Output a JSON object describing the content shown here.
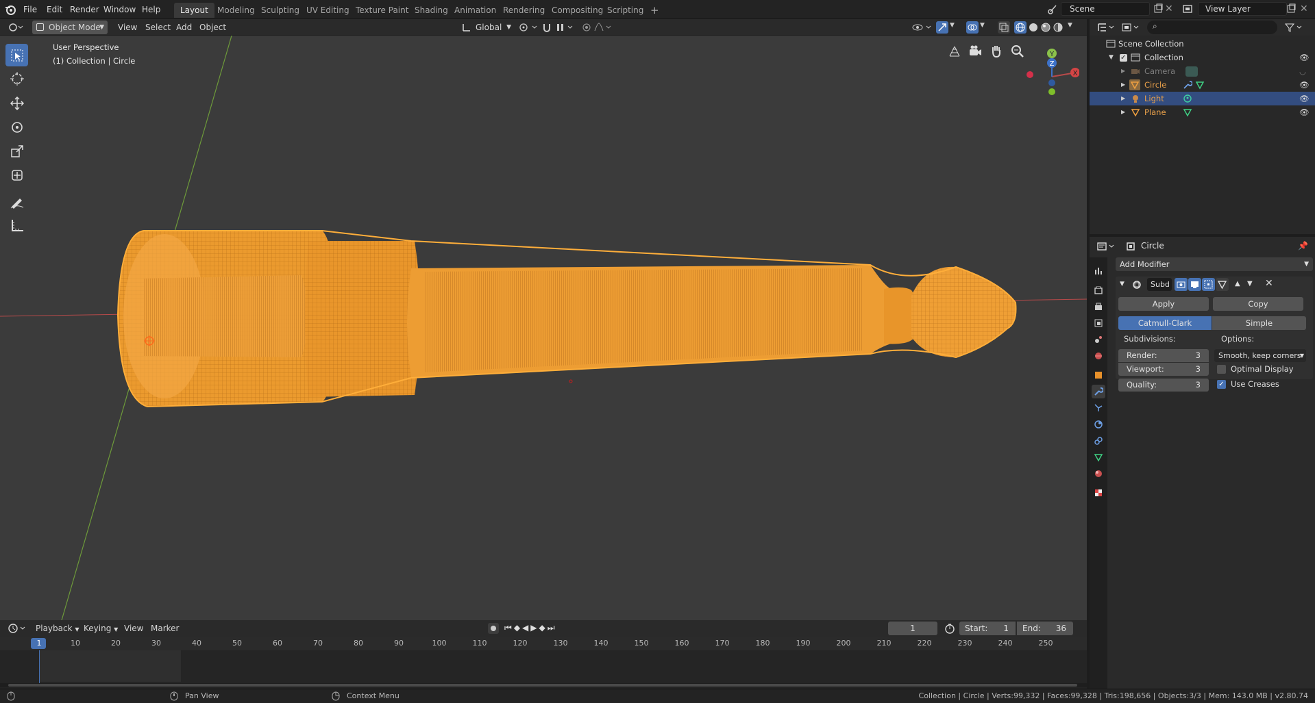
{
  "topbar": {
    "menus": [
      "File",
      "Edit",
      "Render",
      "Window",
      "Help"
    ],
    "workspaces": [
      "Layout",
      "Modeling",
      "Sculpting",
      "UV Editing",
      "Texture Paint",
      "Shading",
      "Animation",
      "Rendering",
      "Compositing",
      "Scripting"
    ],
    "active_workspace": "Layout",
    "add_tab": "+",
    "scene": "Scene",
    "view_layer": "View Layer"
  },
  "viewport": {
    "mode": "Object Mode",
    "menus": [
      "View",
      "Select",
      "Add",
      "Object"
    ],
    "transform_orientation": "Global",
    "overlay_title": "User Perspective",
    "overlay_subtitle": "(1) Collection | Circle",
    "gizmo": {
      "x": "X",
      "y": "Y",
      "z": "Z"
    },
    "object_color": "#f0a02a",
    "background_color": "#3b3b3b",
    "tools": [
      "select-box",
      "cursor",
      "move",
      "rotate",
      "scale",
      "transform",
      "annotate",
      "measure"
    ]
  },
  "outliner": {
    "root": "Scene Collection",
    "collection": "Collection",
    "items": [
      {
        "label": "Camera",
        "color": "#7d7d7d"
      },
      {
        "label": "Circle",
        "color": "#e8a04a"
      },
      {
        "label": "Light",
        "color": "#e8a04a"
      },
      {
        "label": "Plane",
        "color": "#e8a04a"
      }
    ]
  },
  "properties": {
    "object_name": "Circle",
    "add_modifier": "Add Modifier",
    "modifier_name": "Subd",
    "apply": "Apply",
    "copy": "Copy",
    "type_catmull": "Catmull-Clark",
    "type_simple": "Simple",
    "subdivisions_label": "Subdivisions:",
    "options_label": "Options:",
    "render_label": "Render:",
    "render_value": "3",
    "viewport_label": "Viewport:",
    "viewport_value": "3",
    "quality_label": "Quality:",
    "quality_value": "3",
    "uv_smooth": "Smooth, keep corners",
    "optimal_display": "Optimal Display",
    "optimal_display_checked": false,
    "use_creases": "Use Creases",
    "use_creases_checked": true
  },
  "timeline": {
    "menus": [
      "Playback",
      "Keying",
      "View",
      "Marker"
    ],
    "current_frame": "1",
    "start_label": "Start:",
    "start_value": "1",
    "end_label": "End:",
    "end_value": "36",
    "ticks": [
      "1",
      "10",
      "20",
      "30",
      "40",
      "50",
      "60",
      "70",
      "80",
      "90",
      "100",
      "110",
      "120",
      "130",
      "140",
      "150",
      "160",
      "170",
      "180",
      "190",
      "200",
      "210",
      "220",
      "230",
      "240",
      "250"
    ]
  },
  "statusbar": {
    "pan": "Pan View",
    "context": "Context Menu",
    "stats": "Collection | Circle | Verts:99,332 | Faces:99,328 | Tris:198,656 | Objects:3/3 | Mem: 143.0 MB | v2.80.74"
  }
}
